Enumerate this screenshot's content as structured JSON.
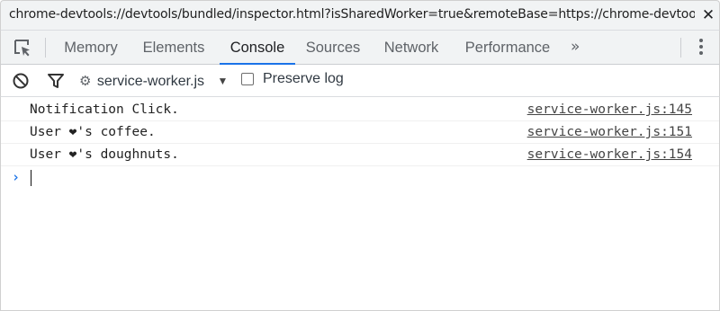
{
  "window": {
    "url": "chrome-devtools://devtools/bundled/inspector.html?isSharedWorker=true&remoteBase=https://chrome-devtools-frontend…",
    "close_icon": "close-icon"
  },
  "tabs": {
    "inspect_icon": "element-picker-icon",
    "items": [
      {
        "label": "Memory"
      },
      {
        "label": "Elements"
      },
      {
        "label": "Console"
      },
      {
        "label": "Sources"
      },
      {
        "label": "Network"
      },
      {
        "label": "Performance"
      }
    ],
    "active": "Console",
    "more_label": "»",
    "menu_icon": "kebab-menu-icon",
    "accent_color": "#1a73e8"
  },
  "toolbar": {
    "clear_icon": "clear-console-icon",
    "filter_icon": "filter-icon",
    "context_gear": "⚙",
    "context_label": "service-worker.js",
    "context_arrow": "▼",
    "preserve_log_label": "Preserve log",
    "preserve_log_checked": false
  },
  "console": {
    "messages": [
      {
        "text": "Notification Click.",
        "source": "service-worker.js:145"
      },
      {
        "text": "User ❤'s coffee.",
        "source": "service-worker.js:151"
      },
      {
        "text": "User ❤'s doughnuts.",
        "source": "service-worker.js:154"
      }
    ],
    "prompt_symbol": "›"
  }
}
